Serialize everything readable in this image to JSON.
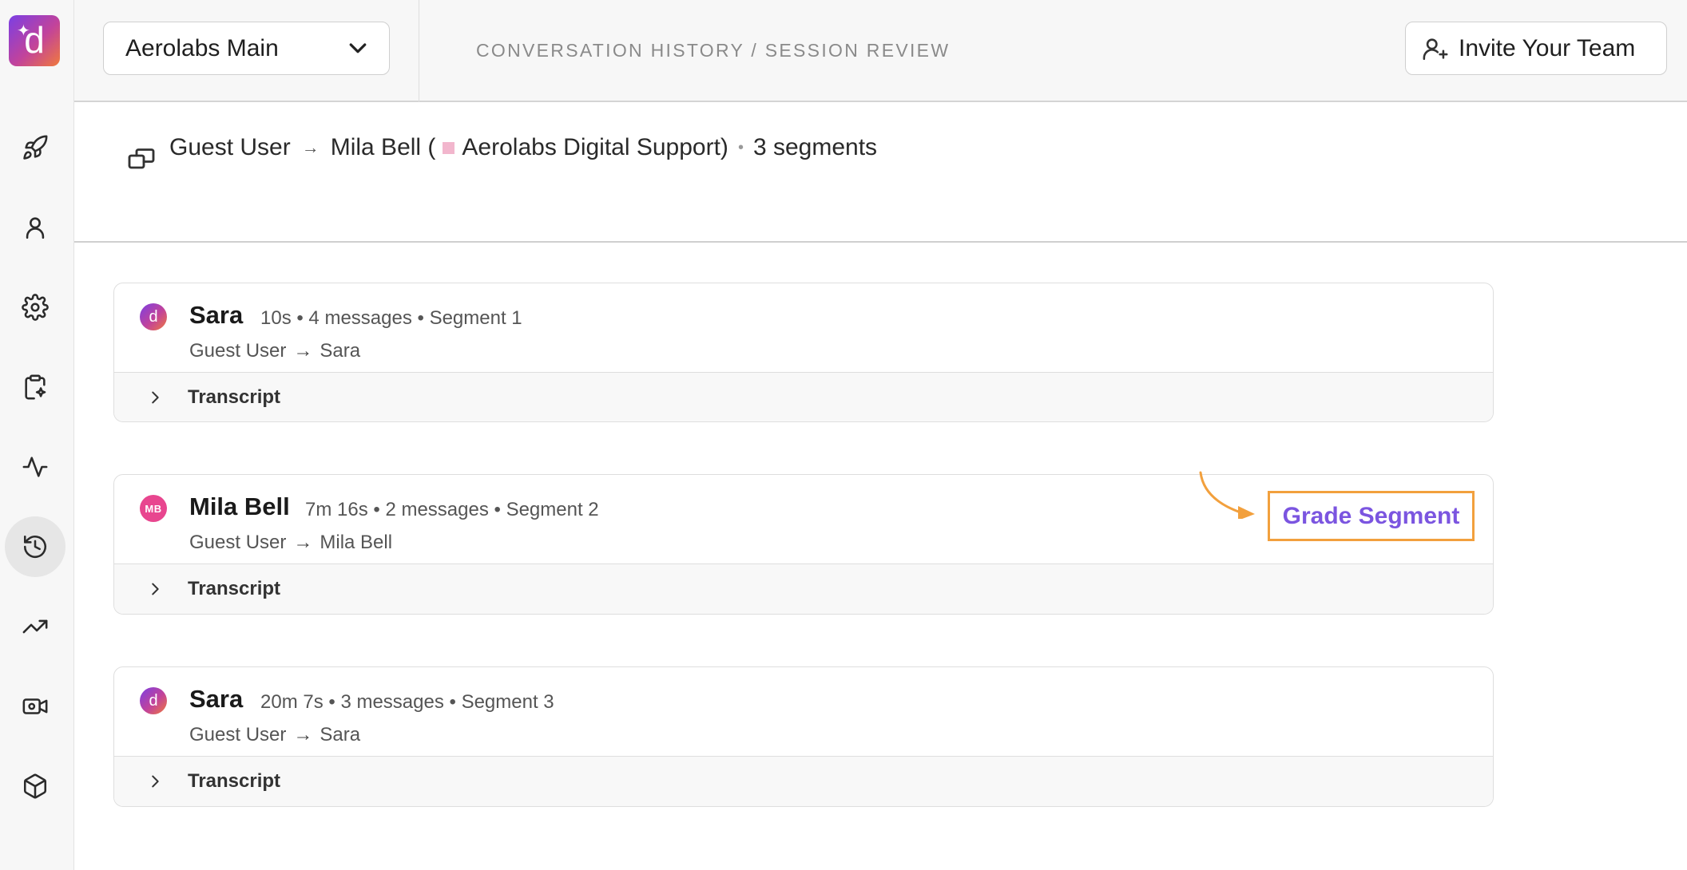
{
  "workspace": {
    "name": "Aerolabs Main"
  },
  "breadcrumb": "CONVERSATION HISTORY / SESSION REVIEW",
  "invite_label": "Invite Your Team",
  "sidebar": {
    "logo_letter": "d",
    "items": [
      {
        "icon": "rocket-icon"
      },
      {
        "icon": "user-icon"
      },
      {
        "icon": "gear-icon"
      },
      {
        "icon": "clipboard-sparkle-icon"
      },
      {
        "icon": "activity-icon"
      },
      {
        "icon": "history-icon",
        "active": true
      },
      {
        "icon": "trending-up-icon"
      },
      {
        "icon": "video-settings-icon"
      },
      {
        "icon": "cube-icon"
      }
    ]
  },
  "session": {
    "from": "Guest User",
    "to": "Mila Bell (",
    "org": "Aerolabs Digital Support)",
    "dot": "•",
    "segments_count": "3 segments"
  },
  "segments": [
    {
      "name": "Sara",
      "avatar": "d",
      "meta": "10s • 4 messages • Segment 1",
      "from": "Guest User",
      "to": "Sara",
      "transcript": "Transcript"
    },
    {
      "name": "Mila Bell",
      "avatar": "MB",
      "meta": "7m 16s • 2 messages • Segment 2",
      "from": "Guest User",
      "to": "Mila Bell",
      "transcript": "Transcript"
    },
    {
      "name": "Sara",
      "avatar": "d",
      "meta": "20m 7s • 3 messages • Segment 3",
      "from": "Guest User",
      "to": "Sara",
      "transcript": "Transcript"
    }
  ],
  "grade_label": "Grade Segment",
  "colors": {
    "accent": "#7b55e0",
    "callout": "#f2a03d",
    "org_tag": "#f2b6cd"
  }
}
